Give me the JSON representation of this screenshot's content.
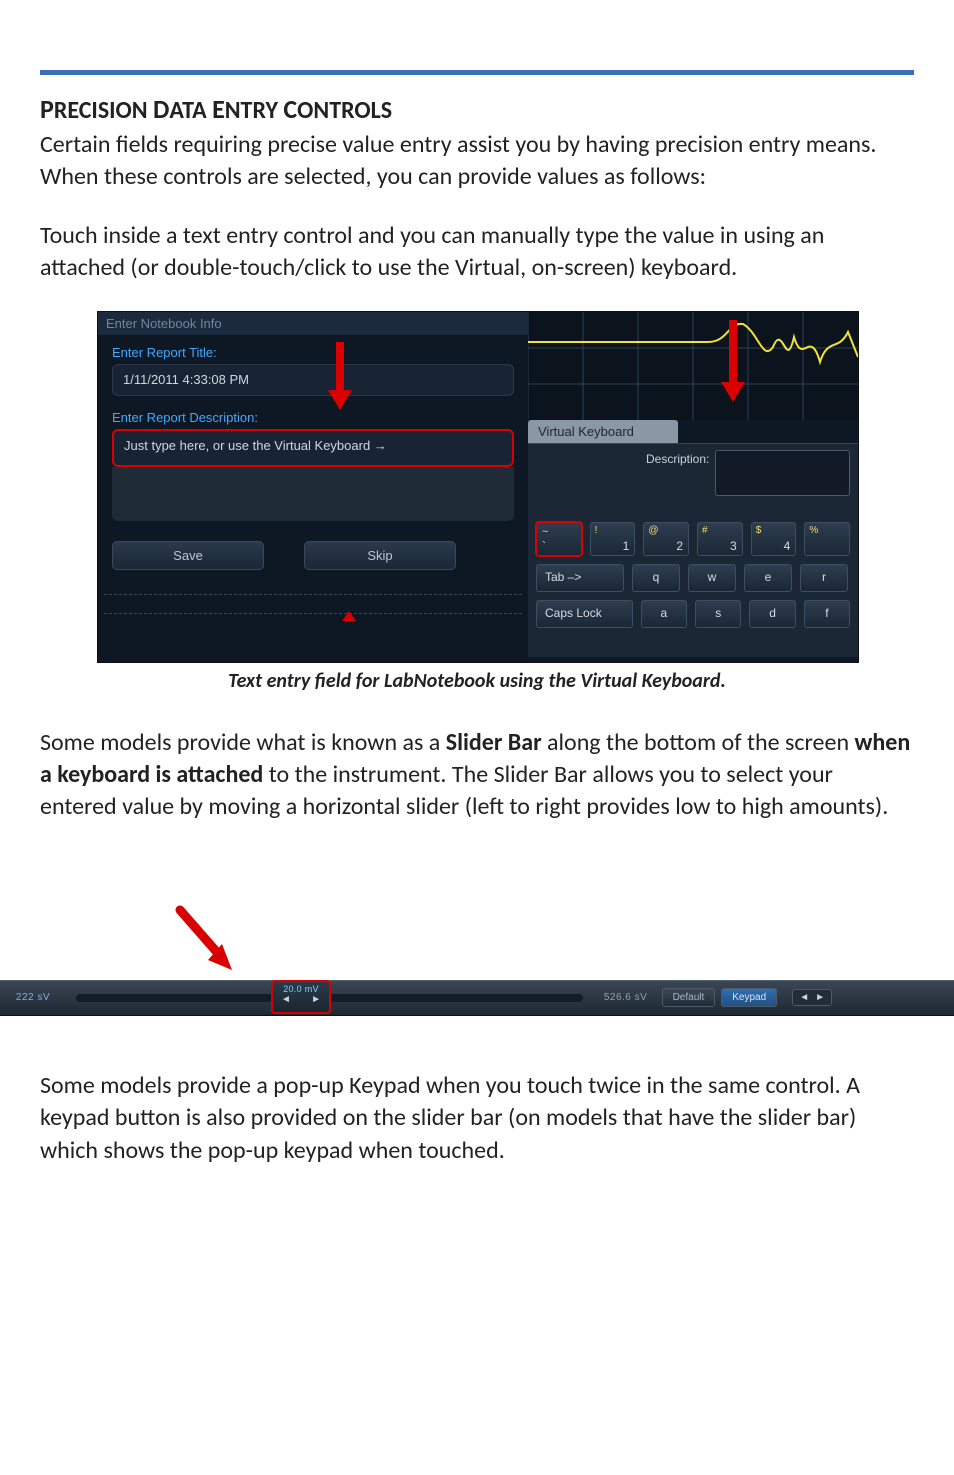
{
  "heading_parts": {
    "p": "P",
    "recision": "RECISION ",
    "d": "D",
    "ata": "ATA ",
    "e": "E",
    "ntry": "NTRY ",
    "c": "C",
    "ontrols": "ONTROLS"
  },
  "para1": "Certain fields requiring precise value entry assist you by having precision entry means. When these controls are selected, you can provide values as follows:",
  "para2": "Touch inside a text entry control and you can manually type the value in using an attached (or double-touch/click to use the Virtual, on-screen) keyboard.",
  "fig1": {
    "window_title": "Enter Notebook Info",
    "title_label": "Enter Report Title:",
    "title_value": "1/11/2011 4:33:08 PM",
    "desc_label": "Enter Report Description:",
    "desc_placeholder": "Just type here, or use the Virtual Keyboard →",
    "save": "Save",
    "skip": "Skip",
    "vk_tab": "Virtual Keyboard",
    "vk_desc_label": "Description:",
    "keys_row1": [
      {
        "sup": "~",
        "main": "`"
      },
      {
        "sup": "!",
        "main": "1"
      },
      {
        "sup": "@",
        "main": "2"
      },
      {
        "sup": "#",
        "main": "3"
      },
      {
        "sup": "$",
        "main": "4"
      },
      {
        "sup": "%",
        "main": ""
      }
    ],
    "tab_key": "Tab –>",
    "letters_row2": [
      "q",
      "w",
      "e",
      "r"
    ],
    "caps_key": "Caps Lock",
    "letters_row3": [
      "a",
      "s",
      "d",
      "f"
    ]
  },
  "caption1": "Text entry field for LabNotebook using the Virtual Keyboard.",
  "para3_a": "Some models provide what is known as a ",
  "para3_b": "Slider Bar",
  "para3_c": " along the bottom of the screen ",
  "para3_d": "when a keyboard is attached",
  "para3_e": " to the instrument. The Slider Bar allows you to select your entered value by moving a horizontal slider (left to right provides low to high amounts).",
  "fig2": {
    "left_readout": "222 sV",
    "knob_value": "20.0 mV",
    "right_readout": "526.6 sV",
    "default_btn": "Default",
    "keypad_btn": "Keypad",
    "nav_left": "◄",
    "nav_right": "►"
  },
  "para4": "Some models provide a pop-up Keypad when you touch twice in the same control. A keypad button is also provided on the slider bar (on models that have the slider bar) which shows the pop-up keypad when touched."
}
